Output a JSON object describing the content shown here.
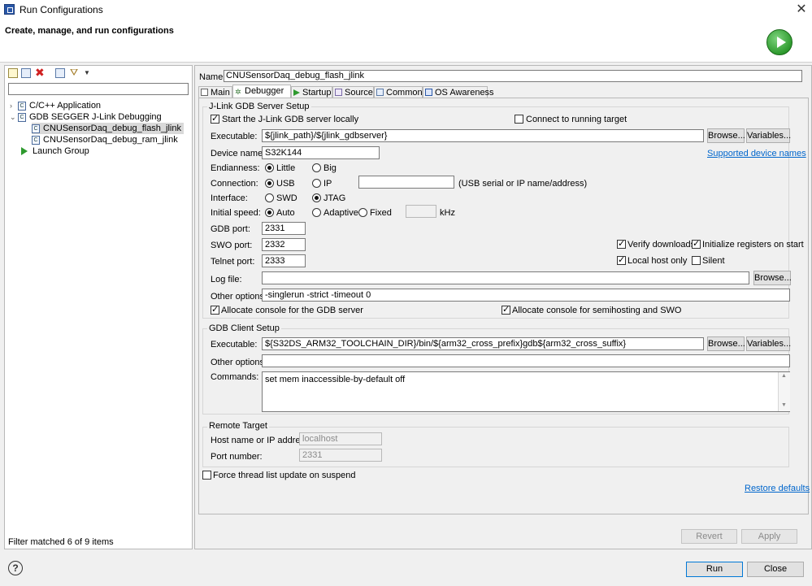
{
  "window": {
    "title": "Run Configurations",
    "heading": "Create, manage, and run configurations"
  },
  "left": {
    "filter_value": "",
    "tree": {
      "cpp": "C/C++ Application",
      "gdb": "GDB SEGGER J-Link Debugging",
      "flash": "CNUSensorDaq_debug_flash_jlink",
      "ram": "CNUSensorDaq_debug_ram_jlink",
      "launch": "Launch Group"
    },
    "filter_msg": "Filter matched 6 of 9 items"
  },
  "config": {
    "name_label": "Name:",
    "name_value": "CNUSensorDaq_debug_flash_jlink",
    "tabs": [
      "Main",
      "Debugger",
      "Startup",
      "Source",
      "Common",
      "OS Awareness"
    ]
  },
  "server": {
    "group": "J-Link GDB Server Setup",
    "start_local": "Start the J-Link GDB server locally",
    "connect_running": "Connect to running target",
    "exec_label": "Executable:",
    "exec_value": "${jlink_path}/${jlink_gdbserver}",
    "browse": "Browse...",
    "variables": "Variables...",
    "device_label": "Device name:",
    "device_value": "S32K144",
    "supported_link": "Supported device names",
    "endian_label": "Endianness:",
    "little": "Little",
    "big": "Big",
    "conn_label": "Connection:",
    "usb": "USB",
    "ip": "IP",
    "conn_hint": "(USB serial or IP name/address)",
    "iface_label": "Interface:",
    "swd": "SWD",
    "jtag": "JTAG",
    "speed_label": "Initial speed:",
    "auto": "Auto",
    "adaptive": "Adaptive",
    "fixed": "Fixed",
    "khz": "kHz",
    "gdbport_label": "GDB port:",
    "gdbport_value": "2331",
    "swoport_label": "SWO port:",
    "swoport_value": "2332",
    "telnet_label": "Telnet port:",
    "telnet_value": "2333",
    "verify": "Verify downloads",
    "init_regs": "Initialize registers on start",
    "localhost_only": "Local host only",
    "silent": "Silent",
    "log_label": "Log file:",
    "other_label": "Other options:",
    "other_value": "-singlerun -strict -timeout 0",
    "alloc_gdb": "Allocate console for the GDB server",
    "alloc_semi": "Allocate console for semihosting and SWO"
  },
  "client": {
    "group": "GDB Client Setup",
    "exec_label": "Executable:",
    "exec_value": "${S32DS_ARM32_TOOLCHAIN_DIR}/bin/${arm32_cross_prefix}gdb${arm32_cross_suffix}",
    "other_label": "Other options:",
    "commands_label": "Commands:",
    "commands_value": "set mem inaccessible-by-default off"
  },
  "remote": {
    "group": "Remote Target",
    "host_label": "Host name or IP address:",
    "host_value": "localhost",
    "port_label": "Port number:",
    "port_value": "2331"
  },
  "misc": {
    "force_thread": "Force thread list update on suspend",
    "restore": "Restore defaults",
    "revert": "Revert",
    "apply": "Apply",
    "run": "Run",
    "close": "Close",
    "help": "?"
  }
}
